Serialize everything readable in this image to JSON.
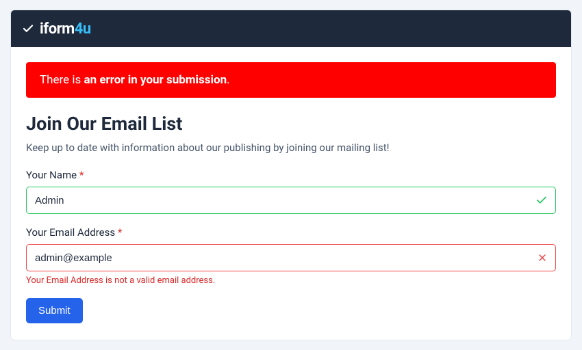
{
  "brand": {
    "pre": "iform",
    "accent": "4",
    "post": "u"
  },
  "alert": {
    "prefix": "There is ",
    "bold": "an error in your submission",
    "suffix": "."
  },
  "form": {
    "title": "Join Our Email List",
    "subtitle": "Keep up to date with information about our publishing by joining our mailing list!",
    "name": {
      "label": "Your Name",
      "required_mark": "*",
      "value": "Admin"
    },
    "email": {
      "label": "Your Email Address",
      "required_mark": "*",
      "value": "admin@example",
      "error": "Your Email Address is not a valid email address."
    },
    "submit_label": "Submit"
  }
}
